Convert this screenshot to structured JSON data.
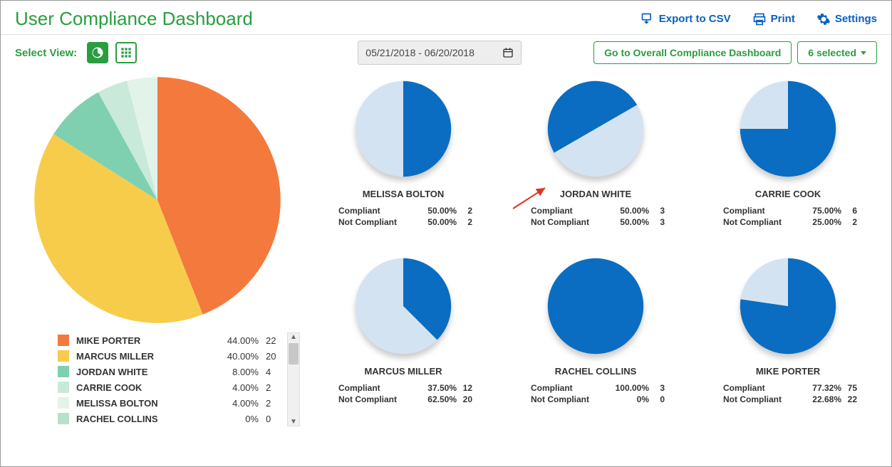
{
  "header": {
    "title": "User Compliance Dashboard",
    "export_label": "Export to CSV",
    "print_label": "Print",
    "settings_label": "Settings"
  },
  "controls": {
    "select_view_label": "Select View:",
    "date_range": "05/21/2018 - 06/20/2018",
    "overall_dashboard_label": "Go to Overall Compliance Dashboard",
    "selection_label": "6 selected"
  },
  "colors": {
    "compliant": "#0a6dc2",
    "not_compliant": "#d4e3f2",
    "green": "#2a9d3f",
    "blue": "#0a5fbf"
  },
  "chart_data": [
    {
      "type": "pie",
      "title": "Overall breakdown",
      "series": [
        {
          "name": "MIKE PORTER",
          "value": 22,
          "pct_label": "44.00%",
          "count_label": "22",
          "color": "#f4793d"
        },
        {
          "name": "MARCUS MILLER",
          "value": 20,
          "pct_label": "40.00%",
          "count_label": "20",
          "color": "#f7cc4b"
        },
        {
          "name": "JORDAN WHITE",
          "value": 4,
          "pct_label": "8.00%",
          "count_label": "4",
          "color": "#7fd0b1"
        },
        {
          "name": "CARRIE COOK",
          "value": 2,
          "pct_label": "4.00%",
          "count_label": "2",
          "color": "#c9e9da"
        },
        {
          "name": "MELISSA BOLTON",
          "value": 2,
          "pct_label": "4.00%",
          "count_label": "2",
          "color": "#e2f3ea"
        },
        {
          "name": "RACHEL COLLINS",
          "value": 0,
          "pct_label": "0%",
          "count_label": "0",
          "color": "#b7e0cd"
        }
      ]
    },
    {
      "type": "pie",
      "title": "MELISSA BOLTON",
      "series": [
        {
          "name": "Compliant",
          "value": 2,
          "pct_label": "50.00%",
          "count_label": "2",
          "color": "#0a6dc2"
        },
        {
          "name": "Not Compliant",
          "value": 2,
          "pct_label": "50.00%",
          "count_label": "2",
          "color": "#d4e3f2"
        }
      ]
    },
    {
      "type": "pie",
      "title": "JORDAN WHITE",
      "series": [
        {
          "name": "Compliant",
          "value": 3,
          "pct_label": "50.00%",
          "count_label": "3",
          "color": "#0a6dc2"
        },
        {
          "name": "Not Compliant",
          "value": 3,
          "pct_label": "50.00%",
          "count_label": "3",
          "color": "#d4e3f2"
        }
      ]
    },
    {
      "type": "pie",
      "title": "CARRIE COOK",
      "series": [
        {
          "name": "Compliant",
          "value": 6,
          "pct_label": "75.00%",
          "count_label": "6",
          "color": "#0a6dc2"
        },
        {
          "name": "Not Compliant",
          "value": 2,
          "pct_label": "25.00%",
          "count_label": "2",
          "color": "#d4e3f2"
        }
      ]
    },
    {
      "type": "pie",
      "title": "MARCUS MILLER",
      "series": [
        {
          "name": "Compliant",
          "value": 12,
          "pct_label": "37.50%",
          "count_label": "12",
          "color": "#0a6dc2"
        },
        {
          "name": "Not Compliant",
          "value": 20,
          "pct_label": "62.50%",
          "count_label": "20",
          "color": "#d4e3f2"
        }
      ]
    },
    {
      "type": "pie",
      "title": "RACHEL COLLINS",
      "series": [
        {
          "name": "Compliant",
          "value": 3,
          "pct_label": "100.00%",
          "count_label": "3",
          "color": "#0a6dc2"
        },
        {
          "name": "Not Compliant",
          "value": 0,
          "pct_label": "0%",
          "count_label": "0",
          "color": "#d4e3f2"
        }
      ]
    },
    {
      "type": "pie",
      "title": "MIKE PORTER",
      "series": [
        {
          "name": "Compliant",
          "value": 75,
          "pct_label": "77.32%",
          "count_label": "75",
          "color": "#0a6dc2"
        },
        {
          "name": "Not Compliant",
          "value": 22,
          "pct_label": "22.68%",
          "count_label": "22",
          "color": "#d4e3f2"
        }
      ]
    }
  ]
}
